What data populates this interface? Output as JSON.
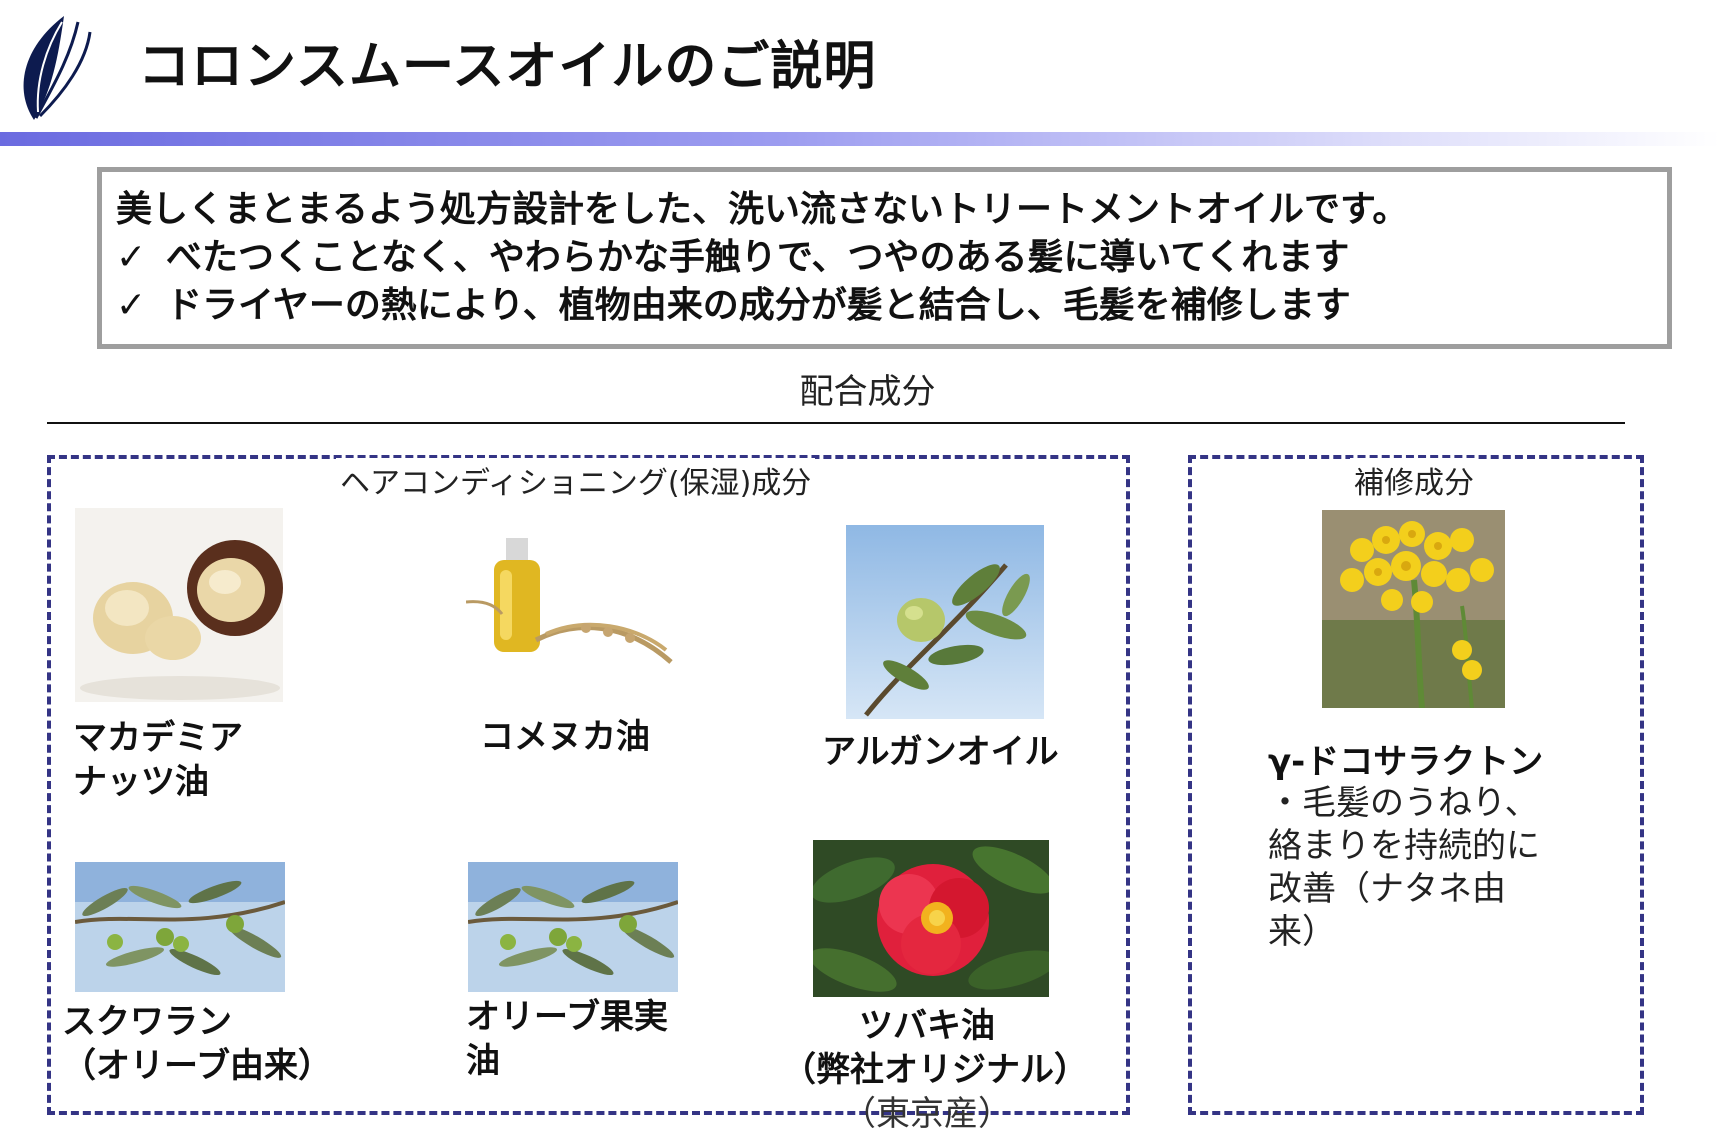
{
  "header": {
    "title": "コロンスムースオイルのご説明",
    "logo_icon": "leaf-logo-icon"
  },
  "summary": {
    "lead": "美しくまとまるよう処方設計をした、洗い流さないトリートメントオイルです。",
    "check_mark": "✓",
    "points": [
      "べたつくことなく、やわらかな手触りで、つやのある髪に導いてくれます",
      "ドライヤーの熱により、植物由来の成分が髪と結合し、毛髪を補修します"
    ]
  },
  "ingredients_heading": "配合成分",
  "conditioning": {
    "heading": "ヘアコンディショニング(保湿)成分",
    "items": [
      {
        "lines": [
          "マカデミア",
          "ナッツ油"
        ],
        "image": "macadamia-nut-photo"
      },
      {
        "lines": [
          "コメヌカ油"
        ],
        "image": "rice-bran-oil-photo"
      },
      {
        "lines": [
          "アルガンオイル"
        ],
        "image": "argan-tree-photo"
      },
      {
        "lines": [
          "スクワラン",
          "（オリーブ由来）"
        ],
        "image": "olive-branch-photo"
      },
      {
        "lines": [
          "オリーブ果実",
          "油"
        ],
        "image": "olive-branch-photo"
      },
      {
        "lines": [
          "ツバキ油",
          "（弊社オリジナル）",
          "（東京産）"
        ],
        "image": "camellia-flower-photo"
      }
    ]
  },
  "repair": {
    "heading": "補修成分",
    "name": "γ-ドコサラクトン",
    "description_lines": [
      "・毛髪のうねり、",
      "絡まりを持続的に",
      "改善（ナタネ由",
      "来）"
    ],
    "image": "rapeseed-flower-photo"
  },
  "colors": {
    "panel_border": "#343485",
    "summary_border": "#9e9e9e",
    "band_start": "#6b6be0"
  }
}
